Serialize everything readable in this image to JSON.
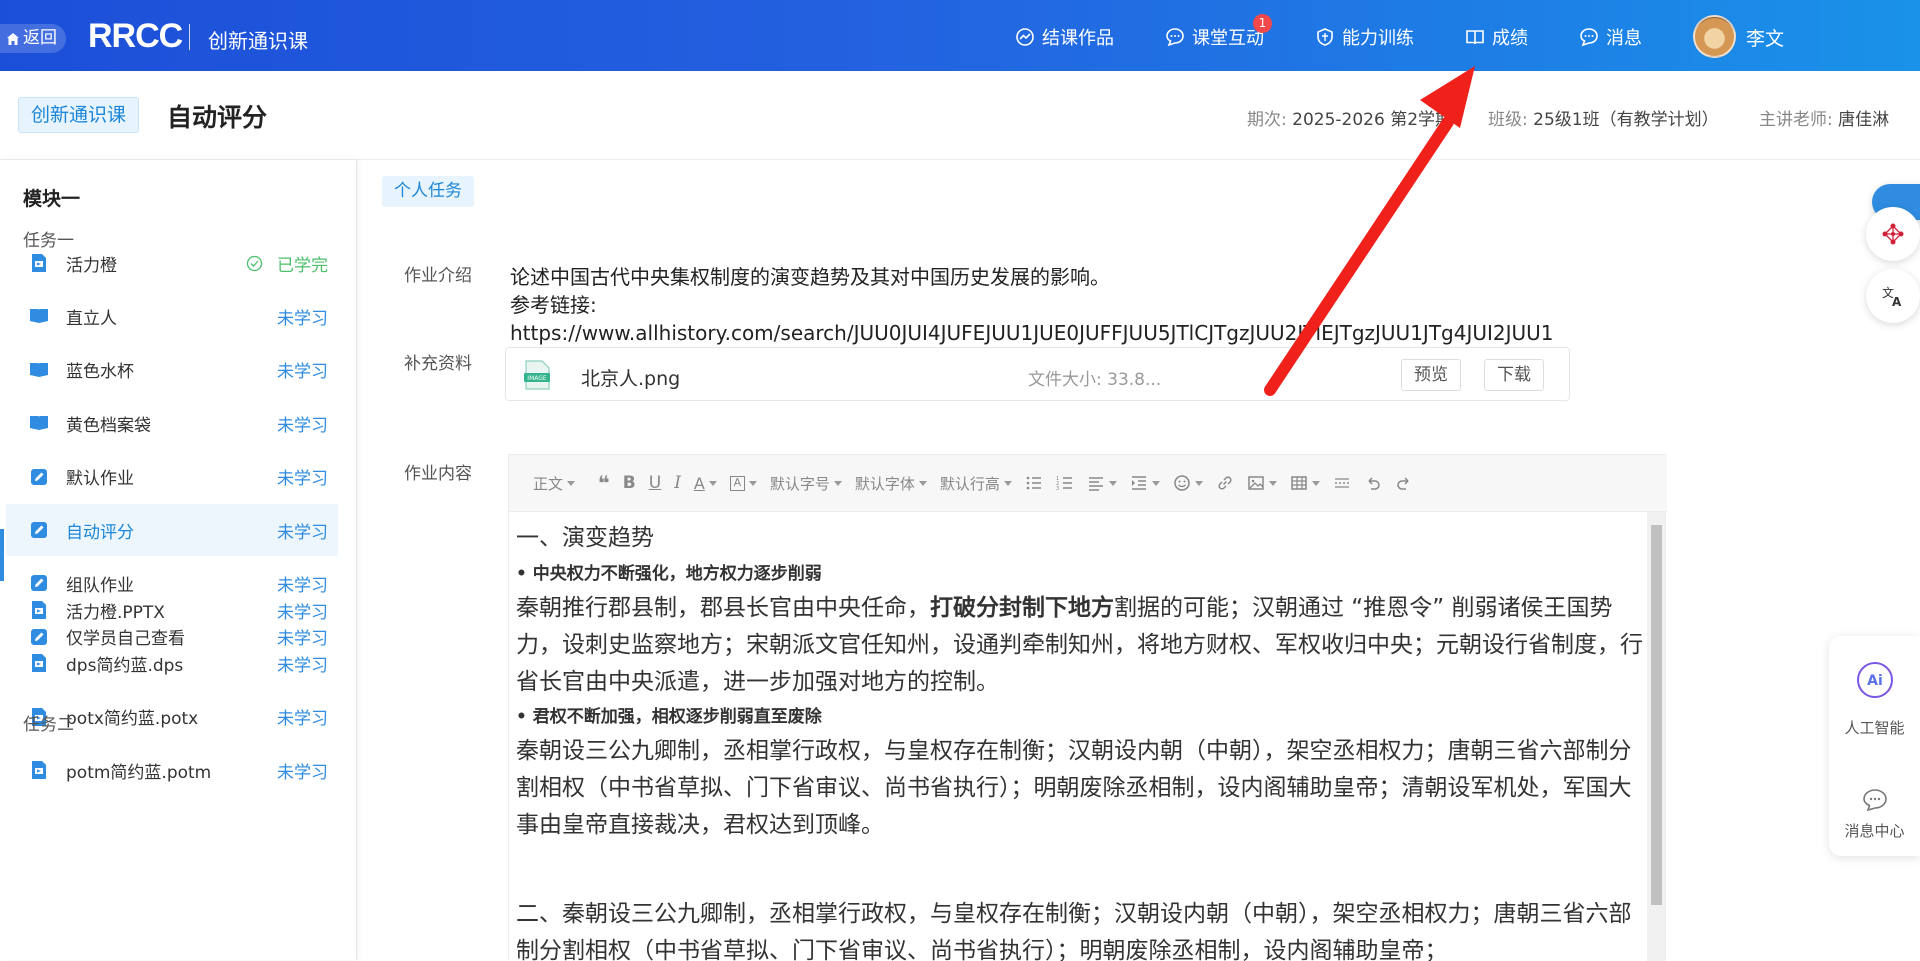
{
  "topbar": {
    "back_label": "返回",
    "logo_text": "RRCC",
    "course_name": "创新通识课",
    "nav": [
      {
        "label": "结课作品",
        "icon": "chart-icon"
      },
      {
        "label": "课堂互动",
        "icon": "chat-icon",
        "badge": "1"
      },
      {
        "label": "能力训练",
        "icon": "shield-icon"
      },
      {
        "label": "成绩",
        "icon": "book-icon"
      },
      {
        "label": "消息",
        "icon": "message-icon"
      }
    ],
    "user_name": "李文"
  },
  "subheader": {
    "course_tag": "创新通识课",
    "page_title": "自动评分",
    "term_label": "期次:",
    "term_value": "2025-2026 第2学期",
    "class_label": "班级:",
    "class_value": "25级1班（有教学计划）",
    "teacher_label": "主讲老师:",
    "teacher_value": "唐佳淋"
  },
  "sidebar": {
    "module_title": "模块一",
    "task1_title": "任务一",
    "task2_title": "任务二",
    "items": [
      {
        "label": "活力橙",
        "status": "已学完",
        "icon": "slides-icon"
      },
      {
        "label": "直立人",
        "status": "未学习",
        "icon": "book-open-icon"
      },
      {
        "label": "蓝色水杯",
        "status": "未学习",
        "icon": "book-open-icon"
      },
      {
        "label": "黄色档案袋",
        "status": "未学习",
        "icon": "book-open-icon"
      },
      {
        "label": "默认作业",
        "status": "未学习",
        "icon": "edit-icon"
      },
      {
        "label": "自动评分",
        "status": "未学习",
        "icon": "edit-icon"
      },
      {
        "label": "组队作业",
        "status": "未学习",
        "icon": "edit-icon"
      },
      {
        "label": "仅学员自己查看",
        "status": "未学习",
        "icon": "edit-icon"
      },
      {
        "label": "活力橙.PPTX",
        "status": "未学习",
        "icon": "slides-icon"
      },
      {
        "label": "dps简约蓝.dps",
        "status": "未学习",
        "icon": "slides-icon"
      },
      {
        "label": "potx简约蓝.potx",
        "status": "未学习",
        "icon": "slides-icon"
      },
      {
        "label": "potm简约蓝.potm",
        "status": "未学习",
        "icon": "slides-icon"
      }
    ]
  },
  "main": {
    "task_tag": "个人任务",
    "intro_label": "作业介绍",
    "intro_line1": "论述中国古代中央集权制度的演变趋势及其对中国历史发展的影响。",
    "intro_line2": "参考链接:",
    "intro_line3": "https://www.allhistory.com/search/JUU0JUI4JUFEJUU1JUE0JUFFJUU5JTlCJTgzJUU2JTlEJTgzJUU1JTg4JUI2JUU1",
    "supp_label": "补充资料",
    "file_name": "北京人.png",
    "file_size": "文件大小: 33.8...",
    "preview_btn": "预览",
    "download_btn": "下载",
    "content_label": "作业内容"
  },
  "toolbar": {
    "paragraph": "正文",
    "font_size": "默认字号",
    "font_family": "默认字体",
    "line_height": "默认行高"
  },
  "editor": {
    "h1": "一、演变趋势",
    "b1": "中央权力不断强化，地方权力逐步削弱",
    "p1_a": "秦朝推行郡县制，郡县长官由中央任命，",
    "p1_bold": "打破分封制下地方",
    "p1_b": "割据的可能；汉朝通过 “推恩令” 削弱诸侯王国势力，设刺史监察地方；宋朝派文官任知州，设通判牵制知州，将地方财权、军权收归中央；元朝设行省制度，行省长官由中央派遣，进一步加强对地方的控制。",
    "b2": "君权不断加强，相权逐步削弱直至废除",
    "p2": "秦朝设三公九卿制，丞相掌行政权，与皇权存在制衡；汉朝设内朝（中朝），架空丞相权力；唐朝三省六部制分割相权（中书省草拟、门下省审议、尚书省执行）；明朝废除丞相制，设内阁辅助皇帝；清朝设军机处，军国大事由皇帝直接裁决，君权达到顶峰。",
    "p3": "二、秦朝设三公九卿制，丞相掌行政权，与皇权存在制衡；汉朝设内朝（中朝），架空丞相权力；唐朝三省六部制分割相权（中书省草拟、门下省审议、尚书省执行）；明朝废除丞相制，设内阁辅助皇帝；"
  },
  "float": {
    "ai_label": "人工智能",
    "msg_label": "消息中心"
  },
  "colors": {
    "accent": "#2f8ce0",
    "done": "#4cbf6a",
    "arrow": "#f0201a"
  }
}
